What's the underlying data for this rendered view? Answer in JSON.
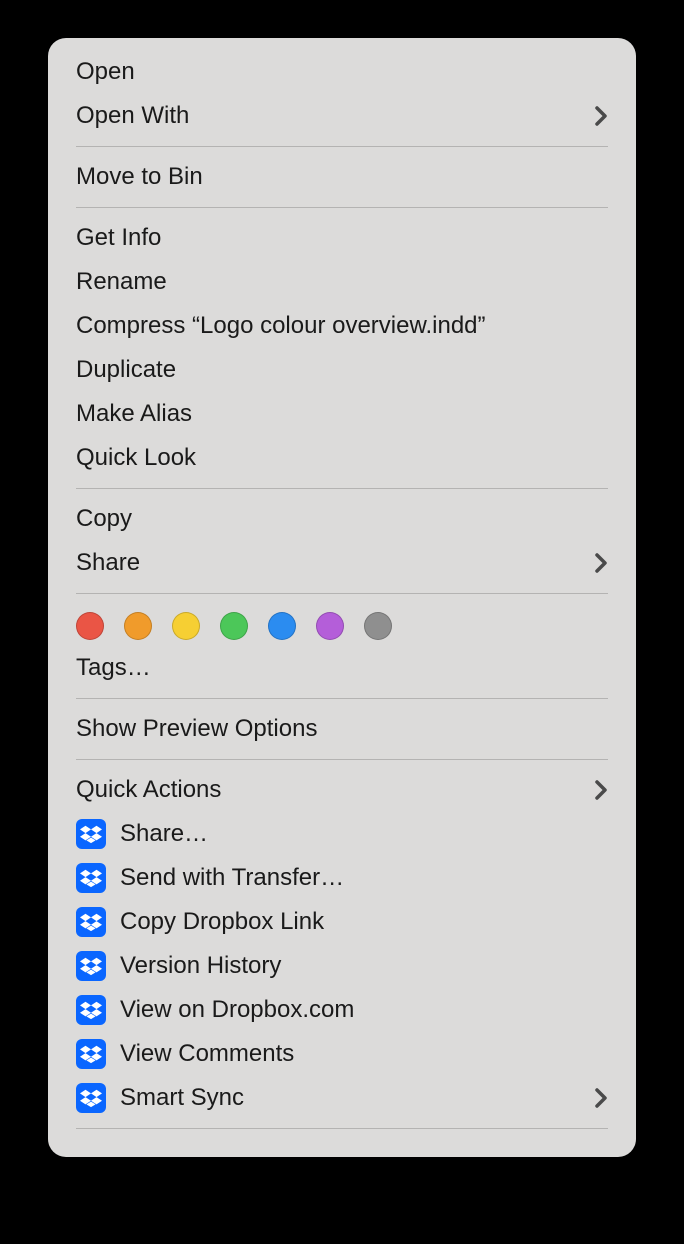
{
  "menu": {
    "open": "Open",
    "open_with": "Open With",
    "move_to_bin": "Move to Bin",
    "get_info": "Get Info",
    "rename": "Rename",
    "compress": "Compress “Logo colour overview.indd”",
    "duplicate": "Duplicate",
    "make_alias": "Make Alias",
    "quick_look": "Quick Look",
    "copy": "Copy",
    "share": "Share",
    "tags": "Tags…",
    "show_preview_options": "Show Preview Options",
    "quick_actions": "Quick Actions",
    "dropbox": {
      "share": "Share…",
      "send_transfer": "Send with Transfer…",
      "copy_link": "Copy Dropbox Link",
      "version_history": "Version History",
      "view_on_site": "View on Dropbox.com",
      "view_comments": "View Comments",
      "smart_sync": "Smart Sync"
    }
  },
  "tag_colors": {
    "red": "#ea5545",
    "orange": "#f09b2b",
    "yellow": "#f6cf33",
    "green": "#4cc759",
    "blue": "#2b8cf0",
    "purple": "#b45ed9",
    "gray": "#8f8f8f"
  }
}
